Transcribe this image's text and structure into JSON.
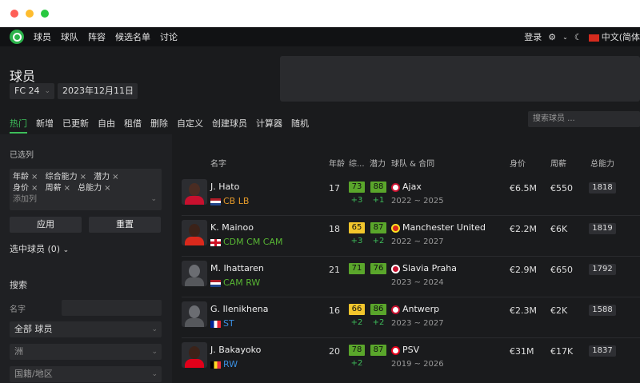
{
  "nav": {
    "items": [
      "球员",
      "球队",
      "阵容",
      "候选名单",
      "讨论"
    ],
    "login": "登录",
    "lang": "中文(简体"
  },
  "page": {
    "title": "球员",
    "game": "FC 24",
    "date": "2023年12月11日"
  },
  "tabs": [
    "热门",
    "新增",
    "已更新",
    "自由",
    "租借",
    "删除",
    "自定义",
    "创建球员",
    "计算器",
    "随机"
  ],
  "search": {
    "placeholder": "搜索球员 ..."
  },
  "sidebar": {
    "selected_cols_label": "已选列",
    "chips": [
      "年龄",
      "综合能力",
      "潜力",
      "身价",
      "周薪",
      "总能力"
    ],
    "add_col": "添加列",
    "apply": "应用",
    "reset": "重置",
    "selected_players": "选中球员 (0)",
    "search_title": "搜索",
    "name_label": "名字",
    "type_select": "全部 球员",
    "continent_select": "洲",
    "nationality_select": "国籍/地区"
  },
  "table": {
    "headers": {
      "name": "名字",
      "age": "年龄",
      "ovr": "综...",
      "pot": "潜力",
      "club": "球队 & 合同",
      "value": "身价",
      "wage": "周薪",
      "total": "总能力"
    },
    "rows": [
      {
        "name": "J. Hato",
        "pos": "CB LB",
        "age": "17",
        "ovr": "73",
        "pot": "88",
        "ovr_gain": "+3",
        "pot_gain": "+1",
        "club": "Ajax",
        "contract": "2022 ~ 2025",
        "value": "€6.5M",
        "wage": "€550",
        "total": "1818"
      },
      {
        "name": "K. Mainoo",
        "pos": "CDM CM CAM",
        "age": "18",
        "ovr": "65",
        "pot": "87",
        "ovr_gain": "+3",
        "pot_gain": "+2",
        "club": "Manchester United",
        "contract": "2022 ~ 2027",
        "value": "€2.2M",
        "wage": "€6K",
        "total": "1819"
      },
      {
        "name": "M. Ihattaren",
        "pos": "CAM RW",
        "age": "21",
        "ovr": "71",
        "pot": "76",
        "ovr_gain": "",
        "pot_gain": "",
        "club": "Slavia Praha",
        "contract": "2023 ~ 2024",
        "value": "€2.9M",
        "wage": "€650",
        "total": "1792"
      },
      {
        "name": "G. Ilenikhena",
        "pos": "ST",
        "age": "16",
        "ovr": "66",
        "pot": "86",
        "ovr_gain": "+2",
        "pot_gain": "+2",
        "club": "Antwerp",
        "contract": "2023 ~ 2027",
        "value": "€2.3M",
        "wage": "€2K",
        "total": "1588"
      },
      {
        "name": "J. Bakayoko",
        "pos": "RW",
        "age": "20",
        "ovr": "78",
        "pot": "87",
        "ovr_gain": "+2",
        "pot_gain": "",
        "club": "PSV",
        "contract": "2019 ~ 2026",
        "value": "€31M",
        "wage": "€17K",
        "total": "1837"
      }
    ]
  },
  "colors": {
    "accent": "#3dbd5a",
    "rating_green": "#5aa62b",
    "rating_yellow": "#f2c62c",
    "pos_orange": "#e59a2a",
    "pos_green": "#58b634",
    "pos_blue": "#3a8ee0"
  }
}
